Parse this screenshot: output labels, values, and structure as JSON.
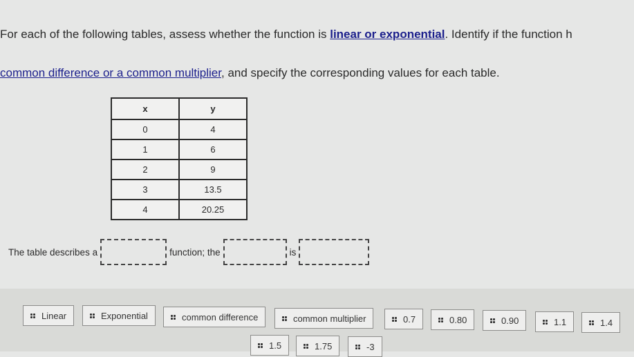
{
  "instructions": {
    "line1_prefix": "For each of the following tables, assess whether the function is ",
    "line1_link": "linear or exponential",
    "line1_suffix": ". Identify if the function h",
    "line2_link": "common difference or a common multiplier",
    "line2_suffix": ", and specify the corresponding values for each table."
  },
  "table": {
    "headers": [
      "x",
      "y"
    ],
    "rows": [
      [
        "0",
        "4"
      ],
      [
        "1",
        "6"
      ],
      [
        "2",
        "9"
      ],
      [
        "3",
        "13.5"
      ],
      [
        "4",
        "20.25"
      ]
    ]
  },
  "sentence": {
    "part1": "The table describes a",
    "part2": "function; the",
    "part3": "is"
  },
  "answer_bank": {
    "icon": "drag-handle-icon",
    "chips": [
      "Linear",
      "Exponential",
      "common difference",
      "common multiplier",
      "0.7",
      "0.80",
      "0.90",
      "1.1",
      "1.4",
      "1.5",
      "1.75",
      "-3"
    ]
  }
}
